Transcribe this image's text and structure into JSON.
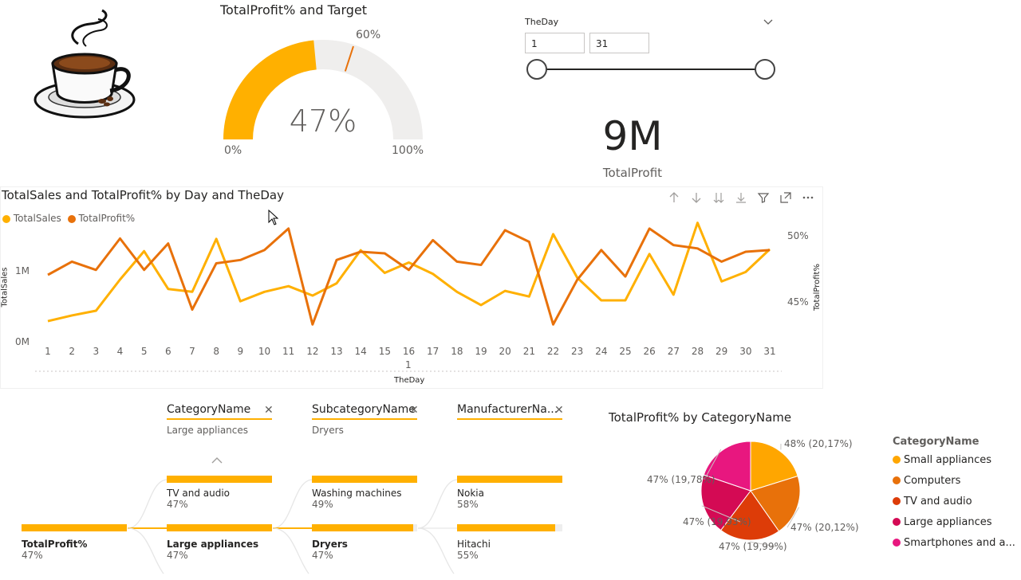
{
  "colors": {
    "accent": "#ffb000",
    "secondary": "#e8710a",
    "gauge_bg": "#efeeed",
    "small_appliances": "#ffa600",
    "computers": "#e8710a",
    "tv_audio": "#dd3c08",
    "large_appliances": "#d40a54",
    "smartphones": "#e8177f"
  },
  "gauge": {
    "title": "TotalProfit% and Target",
    "value_label": "47%",
    "value": 0.47,
    "target": 0.6,
    "target_label": "60%",
    "min_label": "0%",
    "max_label": "100%"
  },
  "slicer": {
    "title": "TheDay",
    "from": "1",
    "to": "31"
  },
  "card": {
    "value": "9M",
    "label": "TotalProfit"
  },
  "line_chart": {
    "title": "TotalSales and TotalProfit% by Day and TheDay",
    "legend": [
      "TotalSales",
      "TotalProfit%"
    ],
    "y_left_label": "TotalSales",
    "y_right_label": "TotalProfit%",
    "x_label": "TheDay",
    "x_sublabel": "1",
    "y_left_ticks": [
      "1M",
      "0M"
    ],
    "y_right_ticks": [
      "50%",
      "45%"
    ]
  },
  "chart_data": {
    "type": "line",
    "title": "TotalSales and TotalProfit% by Day and TheDay",
    "x": [
      1,
      2,
      3,
      4,
      5,
      6,
      7,
      8,
      9,
      10,
      11,
      12,
      13,
      14,
      15,
      16,
      17,
      18,
      19,
      20,
      21,
      22,
      23,
      24,
      25,
      26,
      27,
      28,
      29,
      30,
      31
    ],
    "xlabel": "TheDay",
    "ylabel": "TotalSales",
    "ylabel_right": "TotalProfit%",
    "series": [
      {
        "name": "TotalSales",
        "axis": "left",
        "values": [
          0.21,
          0.27,
          0.32,
          0.65,
          0.95,
          0.55,
          0.52,
          1.08,
          0.42,
          0.52,
          0.58,
          0.48,
          0.61,
          0.96,
          0.72,
          0.83,
          0.71,
          0.52,
          0.38,
          0.53,
          0.47,
          1.13,
          0.67,
          0.43,
          0.43,
          0.92,
          0.49,
          1.25,
          0.63,
          0.73,
          0.97
        ]
      },
      {
        "name": "TotalProfit%",
        "axis": "right",
        "values": [
          47.0,
          47.8,
          47.3,
          49.2,
          47.3,
          48.9,
          44.9,
          47.7,
          47.9,
          48.5,
          49.8,
          44.0,
          47.9,
          48.4,
          48.3,
          47.3,
          49.1,
          47.8,
          47.6,
          49.7,
          49.0,
          44.0,
          46.7,
          48.5,
          46.9,
          49.8,
          48.8,
          48.6,
          47.8,
          48.4,
          48.5
        ]
      }
    ],
    "ylim": [
      0,
      1.5
    ],
    "ylim_right": [
      43,
      51
    ],
    "grid": false,
    "legend": "top-left"
  },
  "decomp": {
    "headers": [
      {
        "name": "CategoryName",
        "sub": "Large appliances"
      },
      {
        "name": "SubcategoryName",
        "sub": "Dryers"
      },
      {
        "name": "ManufacturerNa...",
        "sub": ""
      }
    ],
    "root": {
      "label": "TotalProfit%",
      "value": "47%"
    },
    "col1": [
      {
        "label": "TV and audio",
        "value": "47%",
        "fill": 1.0
      },
      {
        "label": "Large appliances",
        "value": "47%",
        "fill": 1.0
      }
    ],
    "col2": [
      {
        "label": "Washing machines",
        "value": "49%",
        "fill": 1.0
      },
      {
        "label": "Dryers",
        "value": "47%",
        "fill": 0.96
      }
    ],
    "col3": [
      {
        "label": "Nokia",
        "value": "58%",
        "fill": 1.0
      },
      {
        "label": "Hitachi",
        "value": "55%",
        "fill": 0.93
      }
    ]
  },
  "pie": {
    "title": "TotalProfit% by CategoryName",
    "legend_title": "CategoryName",
    "slices": [
      {
        "name": "Small appliances",
        "value": 20.17,
        "label": "48% (20,17%)",
        "color": "#ffa600"
      },
      {
        "name": "Computers",
        "value": 20.12,
        "label": "47% (20,12%)",
        "color": "#e8710a"
      },
      {
        "name": "TV and audio",
        "value": 19.99,
        "label": "47% (19,99%)",
        "color": "#dd3c08"
      },
      {
        "name": "Large appliances",
        "value": 19.93,
        "label": "47% (19,93%)",
        "color": "#d40a54"
      },
      {
        "name": "Smartphones and a...",
        "value": 19.78,
        "label": "47% (19,78%)",
        "color": "#e8177f"
      }
    ]
  }
}
